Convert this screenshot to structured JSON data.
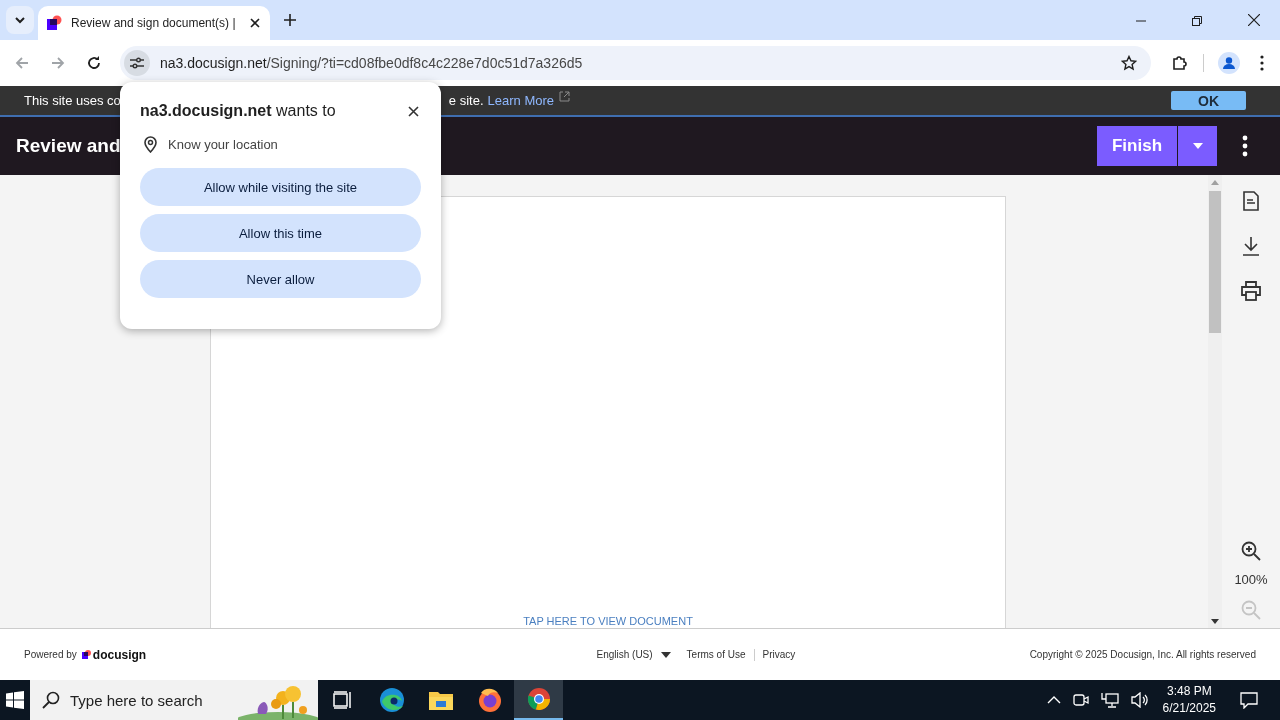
{
  "browser": {
    "tab": {
      "title": "Review and sign document(s) |",
      "selected": true
    },
    "url": {
      "host": "na3.docusign.net",
      "path": "/Signing/?ti=cd08fbe0df8c4c228e7d0c51d7a326d5"
    }
  },
  "cookie_bar": {
    "text_start": "This site uses co",
    "text_end": "e site.",
    "link": "Learn More",
    "ok_button": "OK"
  },
  "header": {
    "title": "Review and",
    "finish_button": "Finish"
  },
  "permission_popup": {
    "title": "**na3.docusign.net** wants to",
    "permission": "Know your location",
    "buttons": [
      "Allow while visiting the site",
      "Allow this time",
      "Never allow"
    ]
  },
  "document": {
    "link": "TAP HERE TO VIEW DOCUMENT"
  },
  "rail": {
    "zoom": "100%"
  },
  "footer": {
    "powered_by": "Powered by",
    "brand": "docusign",
    "language": "English (US)",
    "links": [
      "Terms of Use",
      "Privacy"
    ],
    "copyright": "Copyright © 2025 Docusign, Inc. All rights reserved"
  },
  "taskbar": {
    "search_placeholder": "Type here to search",
    "time": "3:48 PM",
    "date": "6/21/2025",
    "apps": [
      {
        "kind": "task-view",
        "selected": false
      },
      {
        "kind": "edge",
        "selected": false
      },
      {
        "kind": "folder",
        "selected": false
      },
      {
        "kind": "firefox",
        "selected": false
      },
      {
        "kind": "chrome",
        "selected": true
      }
    ]
  }
}
